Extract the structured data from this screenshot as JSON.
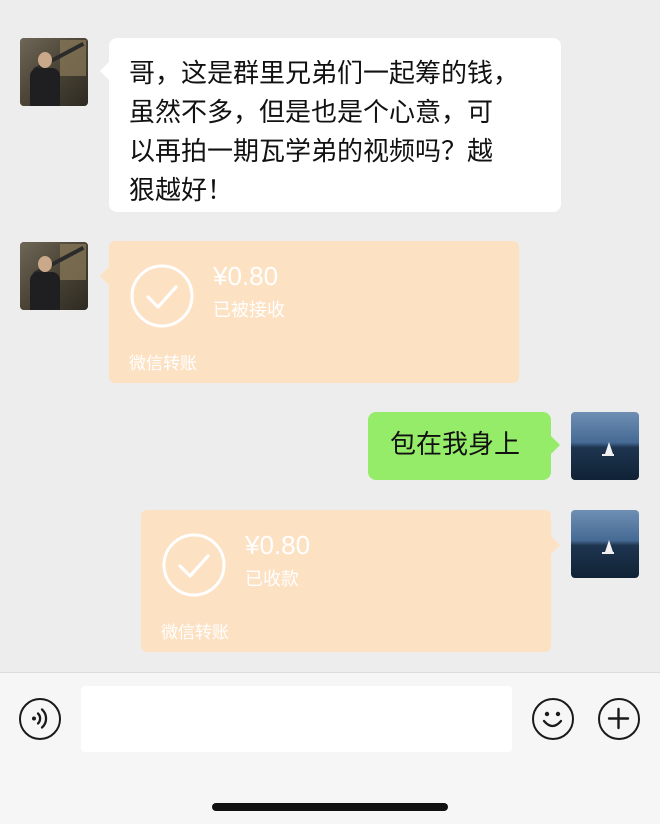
{
  "messages": [
    {
      "type": "text",
      "side": "left",
      "text_lines": [
        "哥，这是群里兄弟们一起筹的钱，",
        "虽然不多，但是也是个心意，可",
        "以再拍一期瓦学弟的视频吗？越",
        "狠越好！"
      ]
    },
    {
      "type": "transfer",
      "side": "left",
      "amount": "¥0.80",
      "status": "已被接收",
      "brand": "微信转账"
    },
    {
      "type": "text",
      "side": "right",
      "text": "包在我身上"
    },
    {
      "type": "transfer",
      "side": "right",
      "amount": "¥0.80",
      "status": "已收款",
      "brand": "微信转账"
    }
  ],
  "icons": {
    "voice": "voice-icon",
    "emoji": "emoji-icon",
    "plus": "plus-icon",
    "check": "check-circle-icon"
  },
  "colors": {
    "background": "#ededed",
    "left_bubble": "#ffffff",
    "right_bubble": "#95ec69",
    "transfer_card": "#fde1c3",
    "bottom_bar": "#f6f6f6"
  }
}
